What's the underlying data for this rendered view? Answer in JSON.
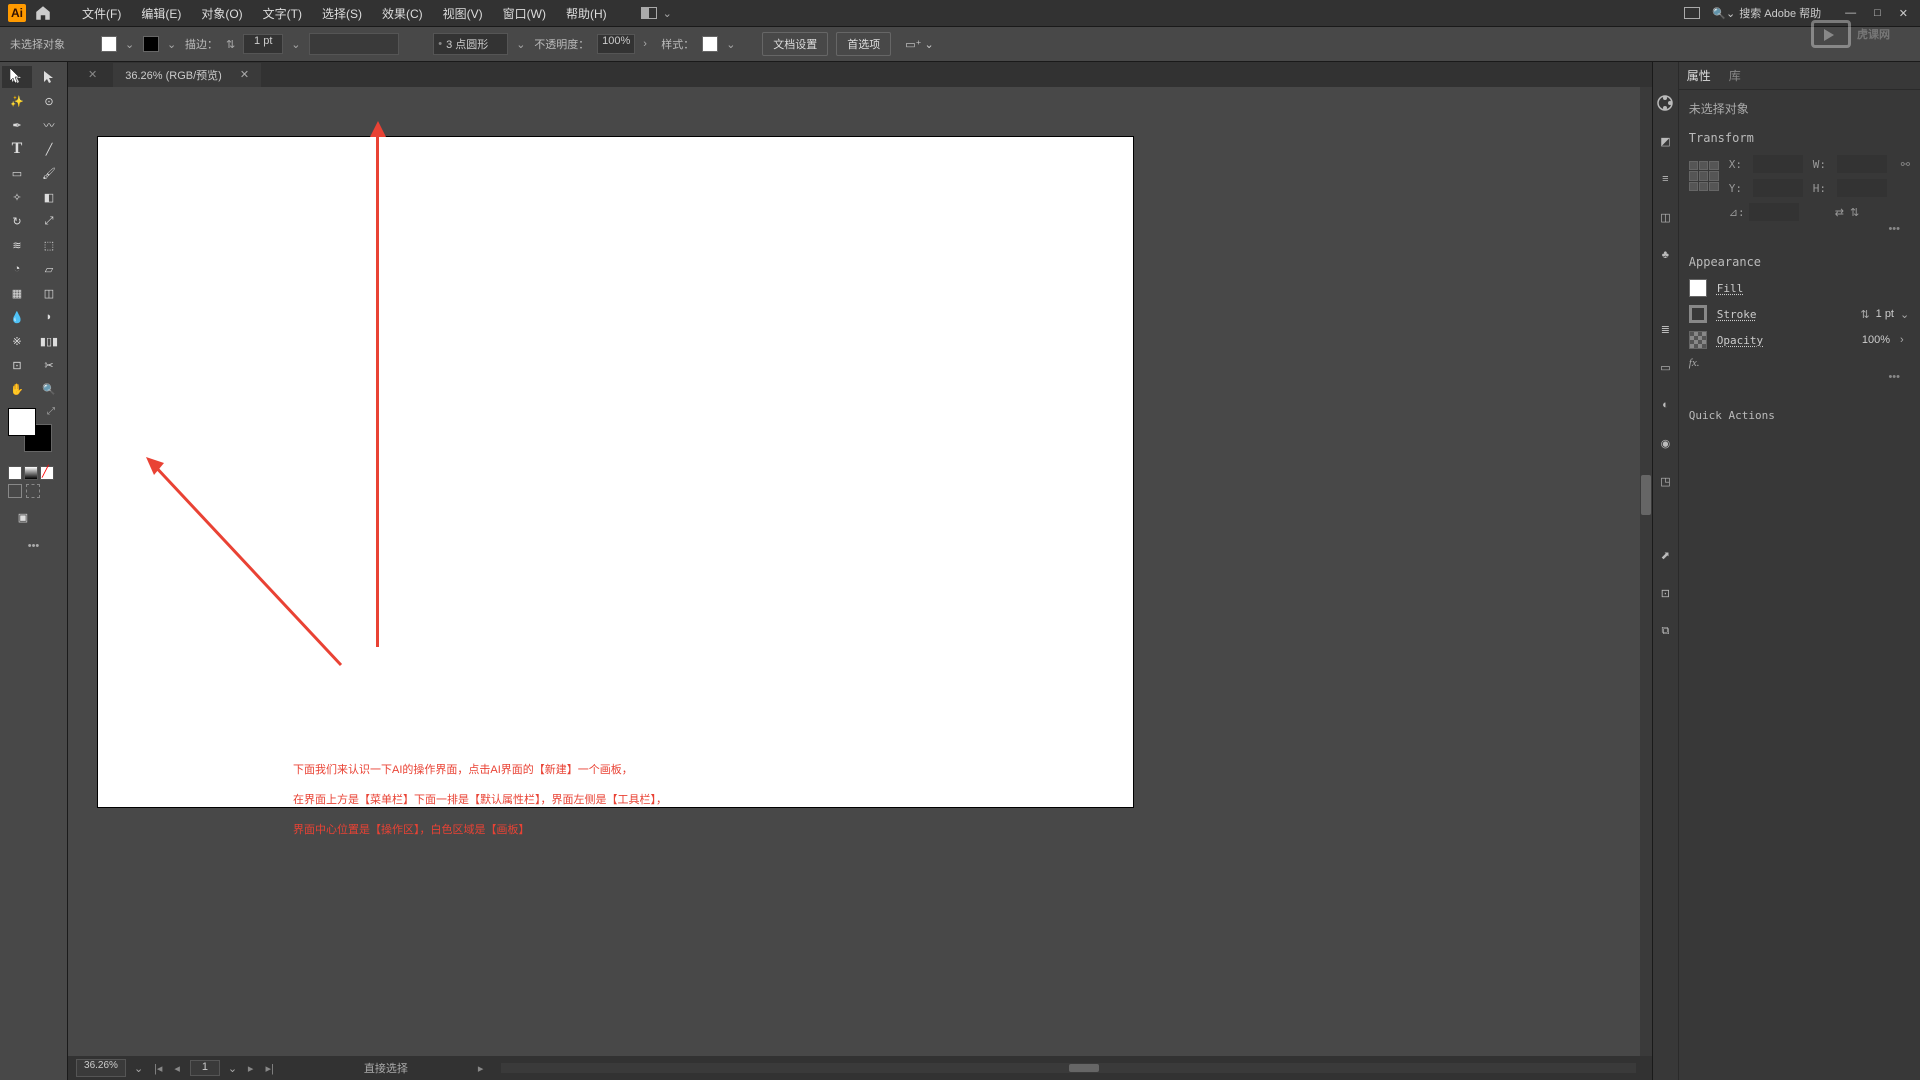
{
  "menubar": {
    "items": [
      "文件(F)",
      "编辑(E)",
      "对象(O)",
      "文字(T)",
      "选择(S)",
      "效果(C)",
      "视图(V)",
      "窗口(W)",
      "帮助(H)"
    ],
    "search_placeholder": "搜索 Adobe 帮助"
  },
  "control": {
    "no_selection": "未选择对象",
    "stroke_label": "描边：",
    "stroke_value": "1 pt",
    "profile_label": "3 点圆形",
    "opacity_label": "不透明度：",
    "opacity_value": "100%",
    "style_label": "样式：",
    "doc_setup": "文档设置",
    "prefs": "首选项"
  },
  "document": {
    "tab_title": "36.26% (RGB/预览)"
  },
  "annotation": {
    "line1": "下面我们来认识一下AI的操作界面，点击AI界面的【新建】一个画板，",
    "line2": "在界面上方是【菜单栏】下面一排是【默认属性栏】，界面左侧是【工具栏】，",
    "line3": "界面中心位置是【操作区】，白色区域是【画板】"
  },
  "status": {
    "zoom": "36.26%",
    "artboard": "1",
    "tool": "直接选择"
  },
  "panels": {
    "tab_properties": "属性",
    "tab_libraries": "库",
    "no_selection": "未选择对象",
    "transform_title": "Transform",
    "x_label": "X:",
    "y_label": "Y:",
    "w_label": "W:",
    "h_label": "H:",
    "angle_label": "⊿:",
    "appearance_title": "Appearance",
    "fill_label": "Fill",
    "stroke_label": "Stroke",
    "stroke_value": "1 pt",
    "opacity_label": "Opacity",
    "opacity_value": "100%",
    "fx_label": "fx.",
    "quick_actions": "Quick Actions"
  },
  "watermark": "虎课网"
}
